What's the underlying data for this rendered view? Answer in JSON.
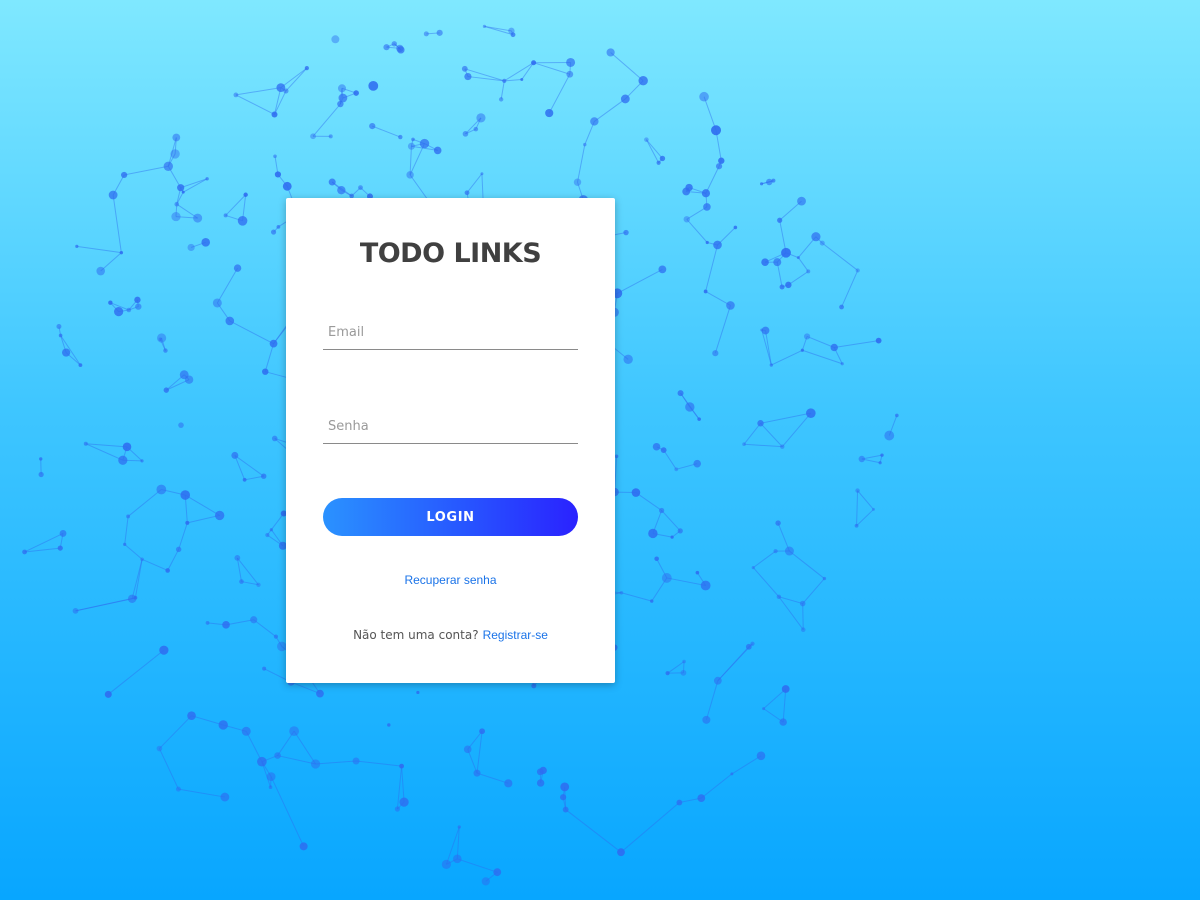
{
  "background": {
    "gradient_top": "#7fe8ff",
    "gradient_bottom": "#08a6ff",
    "network_color": "#2f6cf0"
  },
  "card": {
    "title": "TODO LINKS",
    "email": {
      "value": "",
      "placeholder": "Email"
    },
    "password": {
      "value": "",
      "placeholder": "Senha"
    },
    "login_label": "LOGIN",
    "recover_label": "Recuperar senha",
    "no_account_text": "Não tem uma conta?",
    "register_label": "Registrar-se"
  },
  "colors": {
    "title": "#404040",
    "link": "#1a73e8",
    "button_start": "#2a92ff",
    "button_end": "#2a22ff"
  }
}
